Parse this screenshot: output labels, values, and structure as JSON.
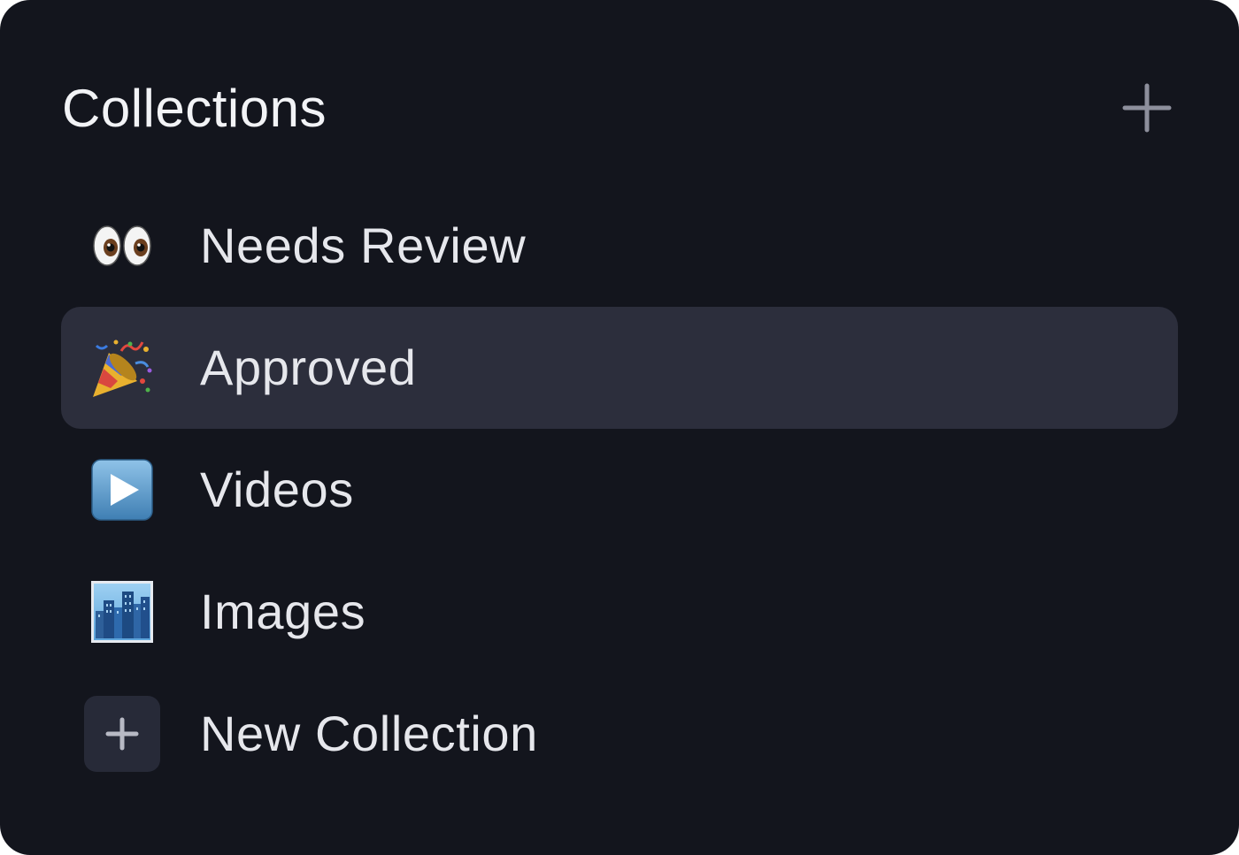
{
  "header": {
    "title": "Collections",
    "add_icon": "plus-icon"
  },
  "collections": [
    {
      "label": "Needs Review",
      "icon": "eyes-emoji-icon",
      "selected": false
    },
    {
      "label": "Approved",
      "icon": "party-popper-emoji-icon",
      "selected": true
    },
    {
      "label": "Videos",
      "icon": "play-button-emoji-icon",
      "selected": false
    },
    {
      "label": "Images",
      "icon": "cityscape-emoji-icon",
      "selected": false
    }
  ],
  "new_collection": {
    "label": "New Collection",
    "icon": "plus-icon"
  },
  "colors": {
    "panel_background": "#13151d",
    "selected_row": "#2c2e3c",
    "text": "#e6e7ec",
    "muted_icon": "#8d8f9c"
  }
}
